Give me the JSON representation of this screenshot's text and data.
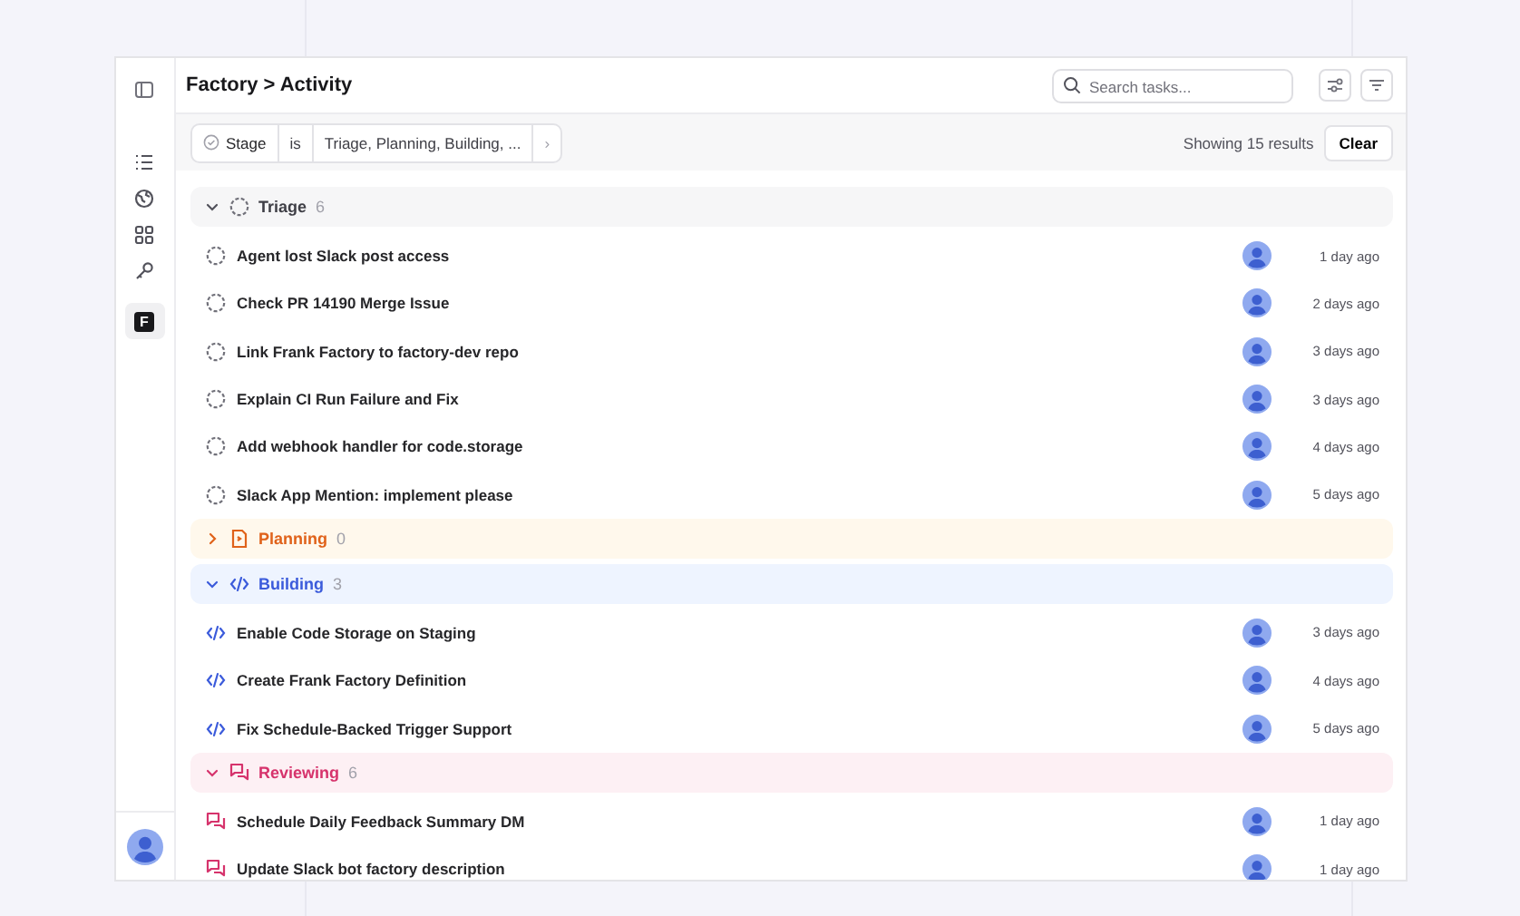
{
  "sidebar": {
    "items": [
      {
        "kind": "list",
        "selected": false
      },
      {
        "kind": "globe",
        "selected": false
      },
      {
        "kind": "grid",
        "selected": false
      },
      {
        "kind": "key",
        "selected": false
      },
      {
        "kind": "logo",
        "label": "F",
        "selected": true
      }
    ]
  },
  "header": {
    "breadcrumb": "Factory > Activity",
    "search": {
      "placeholder": "Search tasks..."
    }
  },
  "filter_bar": {
    "field": "Stage",
    "operator": "is",
    "value": "Triage, Planning, Building, ...",
    "more": "›",
    "results": "Showing 15 results",
    "clear": "Clear"
  },
  "groups": [
    {
      "kind": "triage",
      "name": "Triage",
      "count": "6",
      "expanded": true,
      "color": "#3f3f46",
      "items": [
        {
          "title": "Agent lost Slack post access",
          "time": "1 day ago"
        },
        {
          "title": "Check PR 14190 Merge Issue",
          "time": "2 days ago"
        },
        {
          "title": "Link Frank Factory to factory-dev repo",
          "time": "3 days ago"
        },
        {
          "title": "Explain CI Run Failure and Fix",
          "time": "3 days ago"
        },
        {
          "title": "Add webhook handler for code.storage",
          "time": "4 days ago"
        },
        {
          "title": "Slack App Mention: implement please",
          "time": "5 days ago"
        }
      ]
    },
    {
      "kind": "planning",
      "name": "Planning",
      "count": "0",
      "expanded": false,
      "color": "#e0621a"
    },
    {
      "kind": "building",
      "name": "Building",
      "count": "3",
      "expanded": true,
      "color": "#3b5bdb",
      "items": [
        {
          "title": "Enable Code Storage on Staging",
          "time": "3 days ago"
        },
        {
          "title": "Create Frank Factory Definition",
          "time": "4 days ago"
        },
        {
          "title": "Fix Schedule-Backed Trigger Support",
          "time": "5 days ago"
        }
      ]
    },
    {
      "kind": "reviewing",
      "name": "Reviewing",
      "count": "6",
      "expanded": true,
      "color": "#d6336c",
      "items": [
        {
          "title": "Schedule Daily Feedback Summary DM",
          "time": "1 day ago"
        },
        {
          "title": "Update Slack bot factory description",
          "time": "1 day ago"
        }
      ]
    }
  ]
}
